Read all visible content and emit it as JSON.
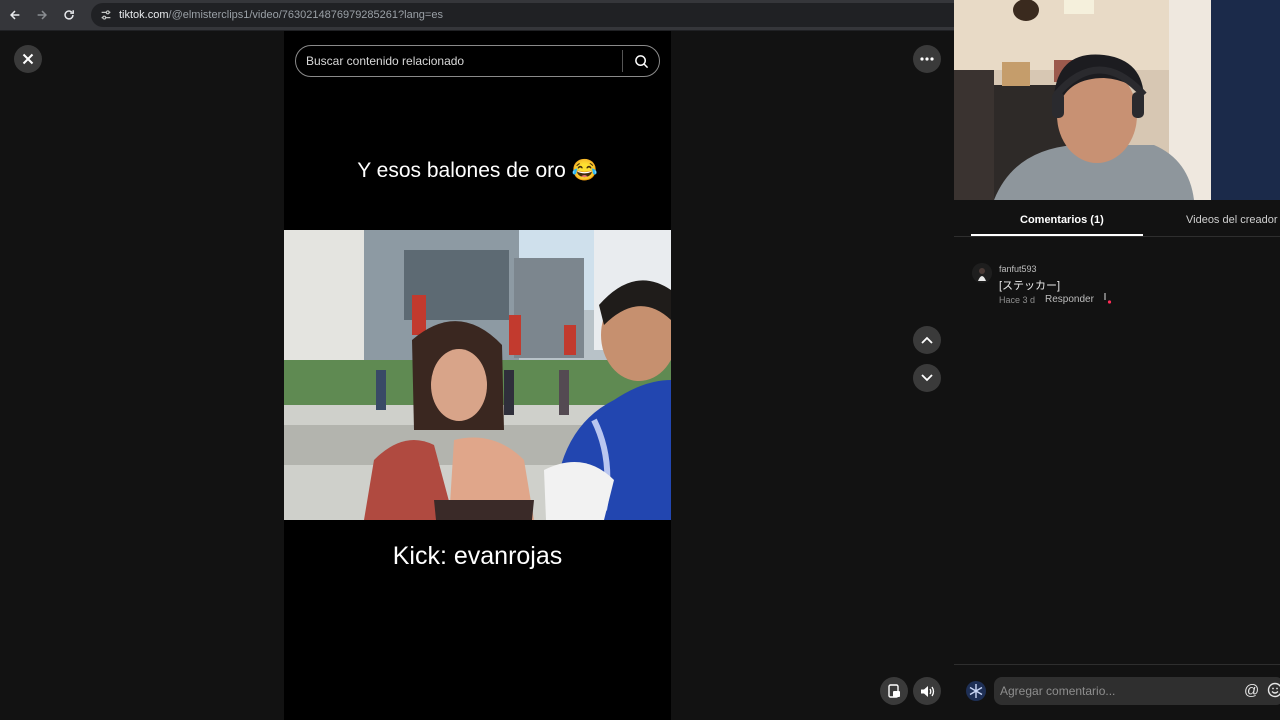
{
  "browser": {
    "url_domain": "tiktok.com",
    "url_rest": "/@elmisterclips1/video/7630214876979285261?lang=es"
  },
  "search": {
    "placeholder": "Buscar contenido relacionado"
  },
  "video": {
    "caption_top": "Y esos balones de oro 😂",
    "caption_bottom": "Kick: evanrojas"
  },
  "side_panel": {
    "tabs": [
      {
        "label": "Comentarios (1)",
        "active": true
      },
      {
        "label": "Videos del creador",
        "active": false
      }
    ],
    "comments": [
      {
        "username": "fanfut593",
        "text": "[ステッカー]",
        "time": "Hace 3 d",
        "reply_label": "Responder"
      }
    ],
    "comment_input_placeholder": "Agregar comentario...",
    "at_symbol": "@"
  },
  "icons": {
    "back": "back-arrow-icon",
    "forward": "forward-arrow-icon",
    "reload": "reload-icon",
    "site_settings": "site-settings-icon",
    "close": "close-icon",
    "more": "more-icon",
    "search": "search-icon",
    "up": "chevron-up-icon",
    "down": "chevron-down-icon",
    "pip": "pip-icon",
    "volume": "volume-icon",
    "like": "heart-icon",
    "avatar": "snowflake-icon",
    "emoji": "emoji-icon"
  },
  "colors": {
    "background": "#121212",
    "video_bg": "#000000",
    "control_bg": "#3a3a3a",
    "accent": "#fe2c55"
  }
}
